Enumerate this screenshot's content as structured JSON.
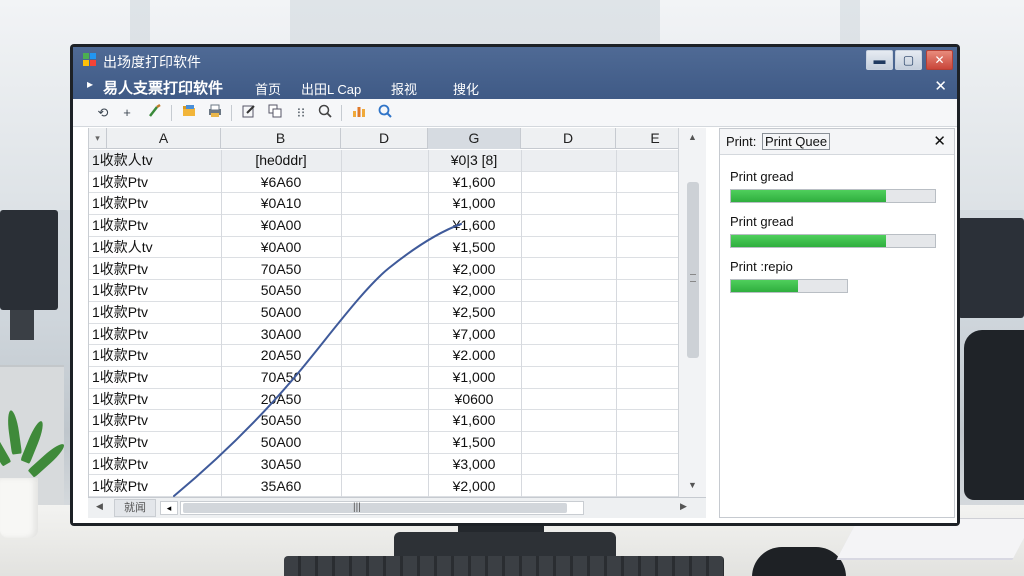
{
  "window": {
    "title": "出场度打印软件",
    "controls": {
      "minimize": "▬",
      "maximize": "▢",
      "close": "✕"
    }
  },
  "menubar": {
    "chevron": "▸",
    "app_name": "易人支票打印软件",
    "items": [
      "首页",
      "出田L Cap",
      "报视",
      "搜化"
    ],
    "close": "✕"
  },
  "toolbar": {
    "icons": [
      "undo-icon",
      "add-icon",
      "brush-icon",
      "folder-icon",
      "print-icon",
      "edit-icon",
      "copy-icon",
      "align-icon",
      "zoom-icon",
      "chart-icon",
      "search-icon"
    ]
  },
  "sheet": {
    "corner": "▾",
    "columns": [
      "A",
      "B",
      "D",
      "G",
      "D",
      "E"
    ],
    "selected_column_index": 3,
    "rows": [
      [
        "1收款人tv",
        "[he0ddr]",
        "¥0|3 [8]"
      ],
      [
        "1收款Ptv",
        "¥6A60",
        "¥1,600"
      ],
      [
        "1收款Ptv",
        "¥0A10",
        "¥1,000"
      ],
      [
        "1收款Ptv",
        "¥0A00",
        "¥1,600"
      ],
      [
        "1收款人tv",
        "¥0A00",
        "¥1,500"
      ],
      [
        "1收款Ptv",
        "70A50",
        "¥2,000"
      ],
      [
        "1收款Ptv",
        "50A50",
        "¥2,000"
      ],
      [
        "1收款Ptv",
        "50A00",
        "¥2,500"
      ],
      [
        "1收款Ptv",
        "30A00",
        "¥7,000"
      ],
      [
        "1收款Ptv",
        "20A50",
        "¥2.000"
      ],
      [
        "1收款Ptv",
        "70A50",
        "¥1,000"
      ],
      [
        "1收款Ptv",
        "20A50",
        "¥0600"
      ],
      [
        "1收款Ptv",
        "50A50",
        "¥1,600"
      ],
      [
        "1收款Ptv",
        "50A00",
        "¥1,500"
      ],
      [
        "1收款Ptv",
        "30A50",
        "¥3,000"
      ],
      [
        "1收款Ptv",
        "35A60",
        "¥2,000"
      ]
    ],
    "sheet_tab": "就闻",
    "nav_button": "◂",
    "hscroll_grip": "|||"
  },
  "colors": {
    "titlebar": "#4a6590",
    "progress": "#3cbf4a",
    "trend_line": "#3f5a9a"
  },
  "print_queue": {
    "title_prefix": "Print:",
    "title_box": "Print Quee",
    "close": "✕",
    "jobs": [
      {
        "label": "Print gread",
        "progress": 0.76
      },
      {
        "label": "Print gread",
        "progress": 0.76
      },
      {
        "label": "Print :repio",
        "progress": 0.58
      }
    ]
  }
}
